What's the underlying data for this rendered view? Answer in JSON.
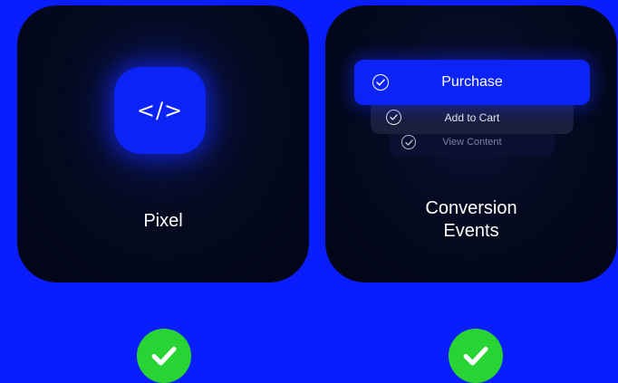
{
  "pixel_card": {
    "code_glyph": "</>",
    "label": "Pixel"
  },
  "conversion_card": {
    "label_line1": "Conversion",
    "label_line2": "Events",
    "events": [
      {
        "label": "Purchase"
      },
      {
        "label": "Add to Cart"
      },
      {
        "label": "View Content"
      }
    ]
  },
  "colors": {
    "background": "#0a1dfc",
    "card": "#030721",
    "accent": "#0b24f5",
    "success": "#27d433"
  },
  "icons": {
    "code": "code-icon",
    "event_check": "check-circle-icon",
    "status": "checkmark-icon"
  }
}
